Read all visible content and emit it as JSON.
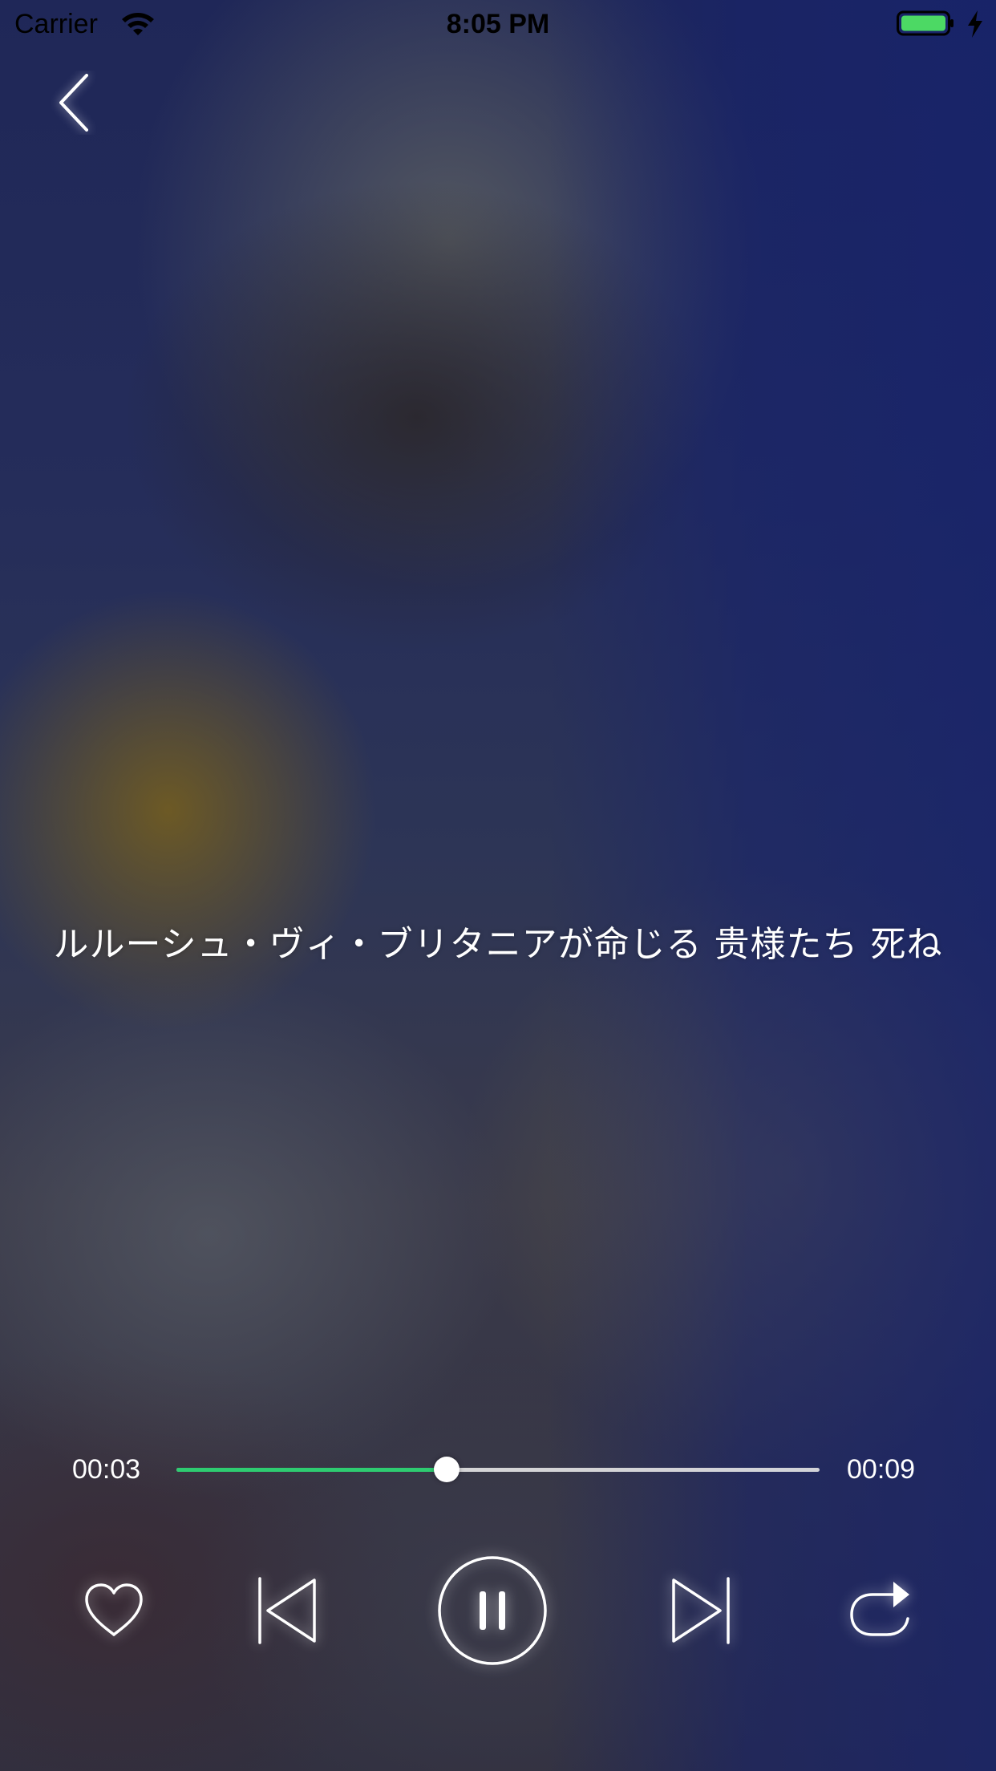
{
  "status_bar": {
    "carrier": "Carrier",
    "time": "8:05 PM",
    "battery_color": "#4cd964",
    "icons": [
      "wifi-icon",
      "battery-icon",
      "charging-bolt-icon"
    ]
  },
  "nav": {
    "back_icon": "chevron-left-icon"
  },
  "lyric": {
    "current_line": "ルルーシュ・ヴィ・ブリタニアが命じる 贵様たち 死ね"
  },
  "player": {
    "elapsed": "00:03",
    "duration": "00:09",
    "progress_fraction": 0.42,
    "progress_color": "#2ecc71",
    "state": "playing",
    "controls": [
      "heart-icon",
      "previous-icon",
      "pause-icon",
      "next-icon",
      "repeat-icon"
    ]
  }
}
